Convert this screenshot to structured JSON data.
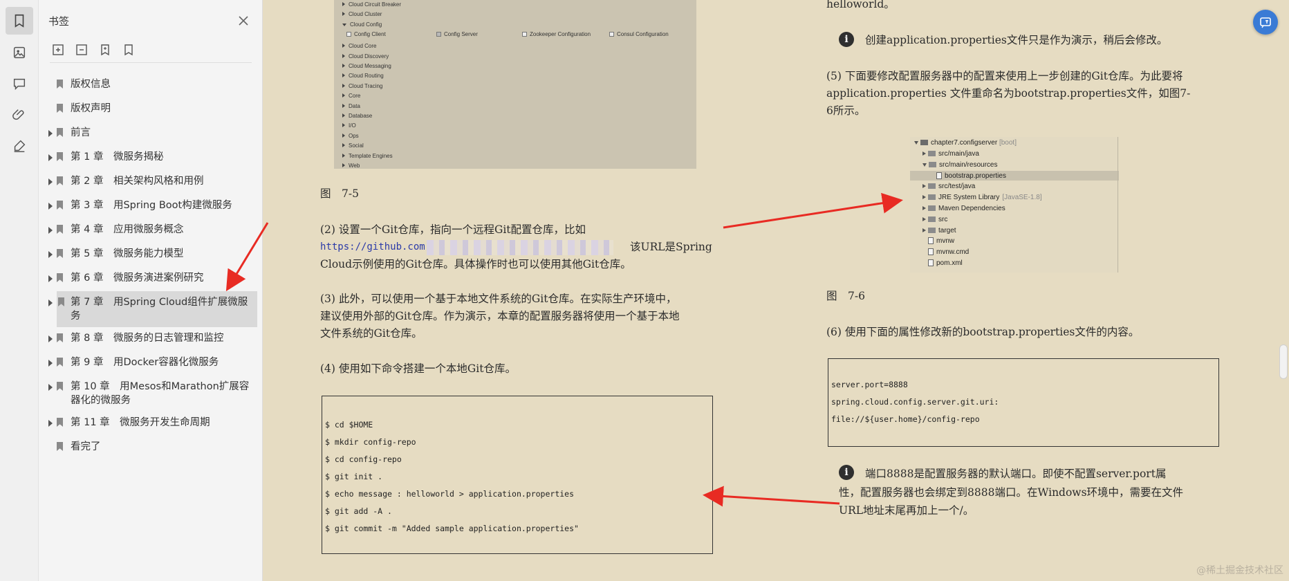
{
  "panel": {
    "title": "书签",
    "items": [
      {
        "label": "版权信息",
        "expandable": false
      },
      {
        "label": "版权声明",
        "expandable": false
      },
      {
        "label": "前言",
        "expandable": true
      },
      {
        "label": "第 1 章　微服务揭秘",
        "expandable": true
      },
      {
        "label": "第 2 章　相关架构风格和用例",
        "expandable": true
      },
      {
        "label": "第 3 章　用Spring Boot构建微服务",
        "expandable": true
      },
      {
        "label": "第 4 章　应用微服务概念",
        "expandable": true
      },
      {
        "label": "第 5 章　微服务能力模型",
        "expandable": true
      },
      {
        "label": "第 6 章　微服务演进案例研究",
        "expandable": true
      },
      {
        "label": "第 7 章　用Spring Cloud组件扩展微服务",
        "expandable": true,
        "selected": true
      },
      {
        "label": "第 8 章　微服务的日志管理和监控",
        "expandable": true
      },
      {
        "label": "第 9 章　用Docker容器化微服务",
        "expandable": true
      },
      {
        "label": "第 10 章　用Mesos和Marathon扩展容器化的微服务",
        "expandable": true
      },
      {
        "label": "第 11 章　微服务开发生命周期",
        "expandable": true
      },
      {
        "label": "看完了",
        "expandable": false
      }
    ]
  },
  "rail": {
    "icons": [
      "bookmark-icon",
      "image-icon",
      "comment-icon",
      "attachment-icon",
      "signature-icon"
    ]
  },
  "doc": {
    "left": {
      "fig_tree": [
        "Cloud Circuit Breaker",
        "Cloud Cluster",
        "Cloud Config",
        "Cloud Core",
        "Cloud Discovery",
        "Cloud Messaging",
        "Cloud Routing",
        "Cloud Tracing",
        "Core",
        "Data",
        "Database",
        "I/O",
        "Ops",
        "Social",
        "Template Engines",
        "Web"
      ],
      "fig_checks": [
        "Config Client",
        "Config Server",
        "Zookeeper Configuration",
        "Consul Configuration"
      ],
      "caption": "图　7-5",
      "p2_line1": "(2) 设置一个Git仓库，指向一个远程Git配置仓库，比如",
      "p2_url": "https://github.com",
      "p2_line2_end": "该URL是Spring",
      "p2_line3": "Cloud示例使用的Git仓库。具体操作时也可以使用其他Git仓库。",
      "p3_line1": "(3) 此外，可以使用一个基于本地文件系统的Git仓库。在实际生产环境中，",
      "p3_line2": "建议使用外部的Git仓库。作为演示，本章的配置服务器将使用一个基于本地",
      "p3_line3": "文件系统的Git仓库。",
      "p4": "(4) 使用如下命令搭建一个本地Git仓库。",
      "code": [
        "$ cd $HOME",
        "$ mkdir config-repo",
        "$ cd config-repo",
        "$ git init .",
        "$ echo message : helloworld > application.properties",
        "$ git add -A .",
        "$ git commit -m \"Added sample application.properties\""
      ]
    },
    "right": {
      "top_text": "helloworld。",
      "info1": "创建application.properties文件只是作为演示，稍后会修改。",
      "p5_line1": "(5) 下面要修改配置服务器中的配置来使用上一步创建的Git仓库。为此要将",
      "p5_line2": "application.properties 文件重命名为bootstrap.properties文件，如图7-",
      "p5_line3": "6所示。",
      "tree": {
        "root": "chapter7.configserver",
        "root_tag": "[boot]",
        "nodes": [
          {
            "label": "src/main/java",
            "type": "folder",
            "state": "collapsed",
            "indent": 1
          },
          {
            "label": "src/main/resources",
            "type": "folder",
            "state": "expanded",
            "indent": 1
          },
          {
            "label": "bootstrap.properties",
            "type": "file",
            "state": "selected",
            "indent": 2
          },
          {
            "label": "src/test/java",
            "type": "folder",
            "state": "collapsed",
            "indent": 1
          },
          {
            "label": "JRE System Library",
            "tag": "[JavaSE-1.8]",
            "type": "lib",
            "state": "collapsed",
            "indent": 1
          },
          {
            "label": "Maven Dependencies",
            "type": "lib",
            "state": "collapsed",
            "indent": 1
          },
          {
            "label": "src",
            "type": "folder",
            "state": "collapsed",
            "indent": 1
          },
          {
            "label": "target",
            "type": "folder",
            "state": "collapsed",
            "indent": 1
          },
          {
            "label": "mvnw",
            "type": "file",
            "indent": 1
          },
          {
            "label": "mvnw.cmd",
            "type": "file",
            "indent": 1
          },
          {
            "label": "pom.xml",
            "type": "file",
            "indent": 1
          }
        ]
      },
      "caption": "图　7-6",
      "p6": "(6) 使用下面的属性修改新的bootstrap.properties文件的内容。",
      "code": [
        "server.port=8888",
        "spring.cloud.config.server.git.uri:",
        "  file://${user.home}/config-repo"
      ],
      "info2_line1": "端口8888是配置服务器的默认端口。即使不配置server.port属",
      "info2_line2": "性，配置服务器也会绑定到8888端口。在Windows环境中，需要在文件",
      "info2_line3": "URL地址末尾再加上一个/。"
    }
  },
  "watermark": "@稀土掘金技术社区",
  "colors": {
    "page_bg": "#e6dcc2",
    "panel_bg": "#f4f4f4",
    "annotation_arrow": "#e82b23",
    "float_button": "#3a7bd5"
  }
}
